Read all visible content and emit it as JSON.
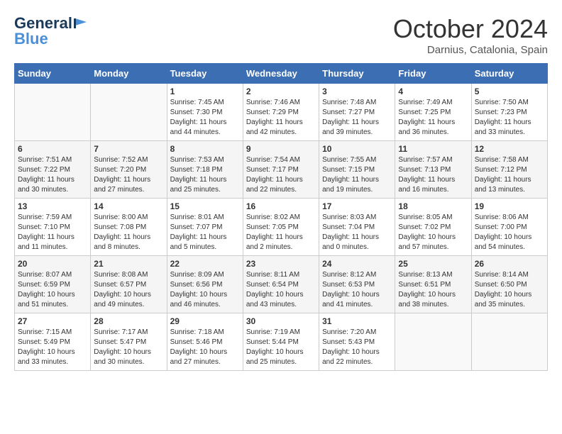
{
  "logo": {
    "general": "General",
    "blue": "Blue"
  },
  "title": "October 2024",
  "location": "Darnius, Catalonia, Spain",
  "header_days": [
    "Sunday",
    "Monday",
    "Tuesday",
    "Wednesday",
    "Thursday",
    "Friday",
    "Saturday"
  ],
  "weeks": [
    [
      {
        "day": "",
        "info": ""
      },
      {
        "day": "",
        "info": ""
      },
      {
        "day": "1",
        "info": "Sunrise: 7:45 AM\nSunset: 7:30 PM\nDaylight: 11 hours and 44 minutes."
      },
      {
        "day": "2",
        "info": "Sunrise: 7:46 AM\nSunset: 7:29 PM\nDaylight: 11 hours and 42 minutes."
      },
      {
        "day": "3",
        "info": "Sunrise: 7:48 AM\nSunset: 7:27 PM\nDaylight: 11 hours and 39 minutes."
      },
      {
        "day": "4",
        "info": "Sunrise: 7:49 AM\nSunset: 7:25 PM\nDaylight: 11 hours and 36 minutes."
      },
      {
        "day": "5",
        "info": "Sunrise: 7:50 AM\nSunset: 7:23 PM\nDaylight: 11 hours and 33 minutes."
      }
    ],
    [
      {
        "day": "6",
        "info": "Sunrise: 7:51 AM\nSunset: 7:22 PM\nDaylight: 11 hours and 30 minutes."
      },
      {
        "day": "7",
        "info": "Sunrise: 7:52 AM\nSunset: 7:20 PM\nDaylight: 11 hours and 27 minutes."
      },
      {
        "day": "8",
        "info": "Sunrise: 7:53 AM\nSunset: 7:18 PM\nDaylight: 11 hours and 25 minutes."
      },
      {
        "day": "9",
        "info": "Sunrise: 7:54 AM\nSunset: 7:17 PM\nDaylight: 11 hours and 22 minutes."
      },
      {
        "day": "10",
        "info": "Sunrise: 7:55 AM\nSunset: 7:15 PM\nDaylight: 11 hours and 19 minutes."
      },
      {
        "day": "11",
        "info": "Sunrise: 7:57 AM\nSunset: 7:13 PM\nDaylight: 11 hours and 16 minutes."
      },
      {
        "day": "12",
        "info": "Sunrise: 7:58 AM\nSunset: 7:12 PM\nDaylight: 11 hours and 13 minutes."
      }
    ],
    [
      {
        "day": "13",
        "info": "Sunrise: 7:59 AM\nSunset: 7:10 PM\nDaylight: 11 hours and 11 minutes."
      },
      {
        "day": "14",
        "info": "Sunrise: 8:00 AM\nSunset: 7:08 PM\nDaylight: 11 hours and 8 minutes."
      },
      {
        "day": "15",
        "info": "Sunrise: 8:01 AM\nSunset: 7:07 PM\nDaylight: 11 hours and 5 minutes."
      },
      {
        "day": "16",
        "info": "Sunrise: 8:02 AM\nSunset: 7:05 PM\nDaylight: 11 hours and 2 minutes."
      },
      {
        "day": "17",
        "info": "Sunrise: 8:03 AM\nSunset: 7:04 PM\nDaylight: 11 hours and 0 minutes."
      },
      {
        "day": "18",
        "info": "Sunrise: 8:05 AM\nSunset: 7:02 PM\nDaylight: 10 hours and 57 minutes."
      },
      {
        "day": "19",
        "info": "Sunrise: 8:06 AM\nSunset: 7:00 PM\nDaylight: 10 hours and 54 minutes."
      }
    ],
    [
      {
        "day": "20",
        "info": "Sunrise: 8:07 AM\nSunset: 6:59 PM\nDaylight: 10 hours and 51 minutes."
      },
      {
        "day": "21",
        "info": "Sunrise: 8:08 AM\nSunset: 6:57 PM\nDaylight: 10 hours and 49 minutes."
      },
      {
        "day": "22",
        "info": "Sunrise: 8:09 AM\nSunset: 6:56 PM\nDaylight: 10 hours and 46 minutes."
      },
      {
        "day": "23",
        "info": "Sunrise: 8:11 AM\nSunset: 6:54 PM\nDaylight: 10 hours and 43 minutes."
      },
      {
        "day": "24",
        "info": "Sunrise: 8:12 AM\nSunset: 6:53 PM\nDaylight: 10 hours and 41 minutes."
      },
      {
        "day": "25",
        "info": "Sunrise: 8:13 AM\nSunset: 6:51 PM\nDaylight: 10 hours and 38 minutes."
      },
      {
        "day": "26",
        "info": "Sunrise: 8:14 AM\nSunset: 6:50 PM\nDaylight: 10 hours and 35 minutes."
      }
    ],
    [
      {
        "day": "27",
        "info": "Sunrise: 7:15 AM\nSunset: 5:49 PM\nDaylight: 10 hours and 33 minutes."
      },
      {
        "day": "28",
        "info": "Sunrise: 7:17 AM\nSunset: 5:47 PM\nDaylight: 10 hours and 30 minutes."
      },
      {
        "day": "29",
        "info": "Sunrise: 7:18 AM\nSunset: 5:46 PM\nDaylight: 10 hours and 27 minutes."
      },
      {
        "day": "30",
        "info": "Sunrise: 7:19 AM\nSunset: 5:44 PM\nDaylight: 10 hours and 25 minutes."
      },
      {
        "day": "31",
        "info": "Sunrise: 7:20 AM\nSunset: 5:43 PM\nDaylight: 10 hours and 22 minutes."
      },
      {
        "day": "",
        "info": ""
      },
      {
        "day": "",
        "info": ""
      }
    ]
  ]
}
